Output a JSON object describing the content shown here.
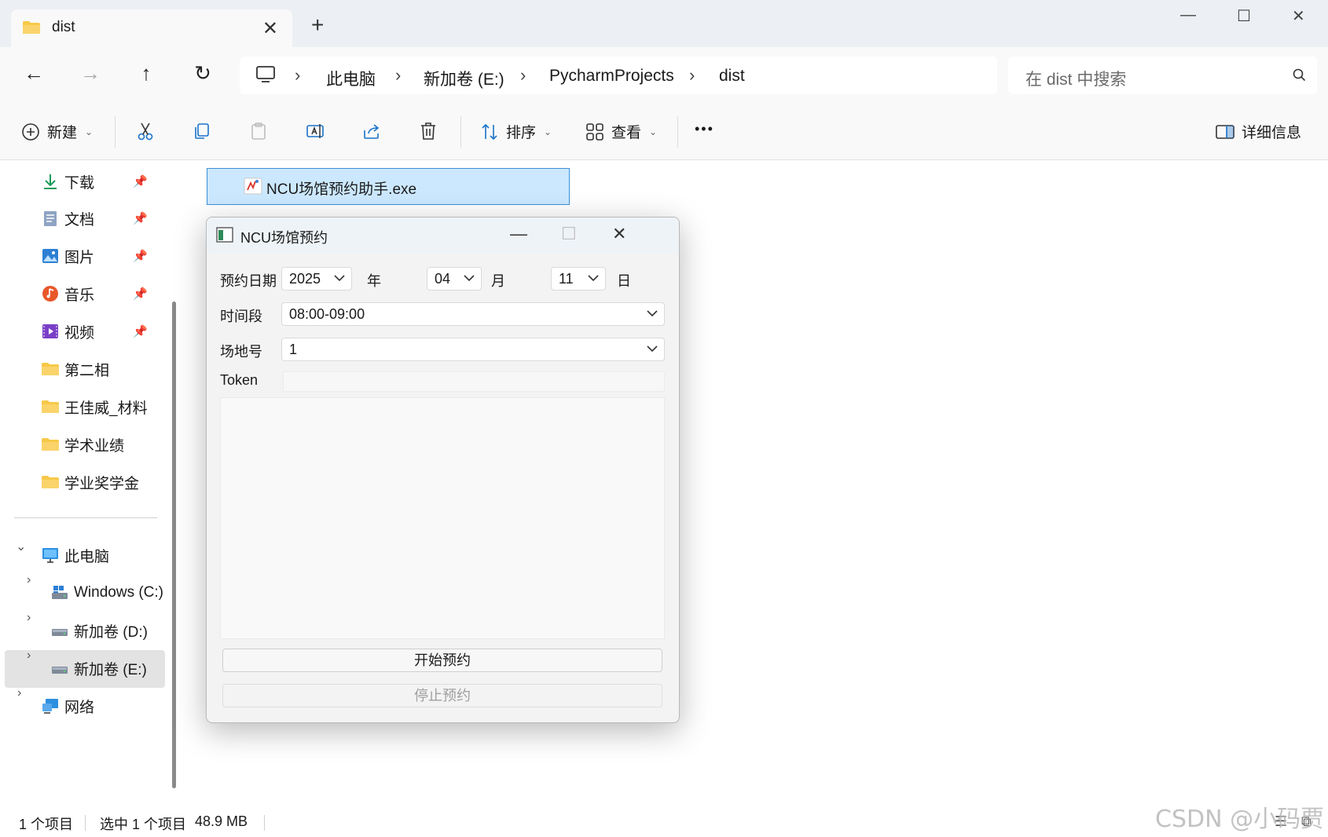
{
  "window": {
    "tab_title": "dist",
    "tab_close": "✕",
    "new_tab": "+",
    "minimize": "—",
    "maximize": "☐",
    "close": "✕"
  },
  "nav": {
    "back": "←",
    "forward": "→",
    "up": "↑",
    "refresh": "↻",
    "breadcrumbs": [
      "此电脑",
      "新加卷 (E:)",
      "PycharmProjects",
      "dist"
    ],
    "separator": "›",
    "search_placeholder": "在 dist 中搜索"
  },
  "toolbar": {
    "new_label": "新建",
    "sort_label": "排序",
    "view_label": "查看",
    "more_label": "•••",
    "details_label": "详细信息",
    "caret": "⌄"
  },
  "sidebar": {
    "quick": [
      {
        "label": "下载",
        "icon": "download-icon"
      },
      {
        "label": "文档",
        "icon": "document-icon"
      },
      {
        "label": "图片",
        "icon": "pictures-icon"
      },
      {
        "label": "音乐",
        "icon": "music-icon"
      },
      {
        "label": "视频",
        "icon": "video-icon"
      }
    ],
    "folders": [
      "第二相",
      "王佳威_材料",
      "学术业绩",
      "学业奖学金"
    ],
    "pin": "📌",
    "this_pc": "此电脑",
    "drives": [
      "Windows (C:)",
      "新加卷 (D:)",
      "新加卷 (E:)"
    ],
    "network": "网络",
    "chevron_open": "⌄",
    "chevron_closed": "›"
  },
  "content": {
    "file_name": "NCU场馆预约助手.exe"
  },
  "dialog": {
    "title": "NCU场馆预约",
    "minimize": "—",
    "maximize": "☐",
    "close": "✕",
    "date_label": "预约日期",
    "year_value": "2025",
    "year_unit": "年",
    "month_value": "04",
    "month_unit": "月",
    "day_value": "11",
    "day_unit": "日",
    "time_label": "时间段",
    "time_value": "08:00-09:00",
    "court_label": "场地号",
    "court_value": "1",
    "token_label": "Token",
    "token_value": "",
    "start_button": "开始预约",
    "stop_button": "停止预约"
  },
  "status": {
    "item_count": "1 个项目",
    "selected": "选中 1 个项目",
    "size": "48.9 MB",
    "watermark": "CSDN @小码贾"
  },
  "colors": {
    "selection_bg": "#cce8ff",
    "selection_border": "#3c8fd6",
    "folder_yellow": "#f7c948",
    "accent_blue": "#1a73c9"
  }
}
